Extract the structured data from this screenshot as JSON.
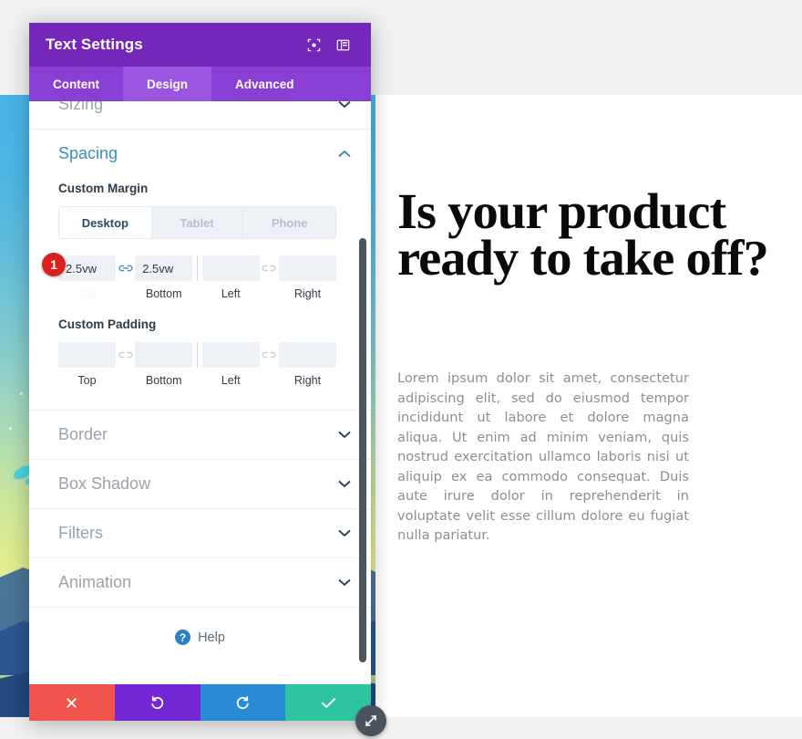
{
  "modal": {
    "title": "Text Settings",
    "header_icons": [
      {
        "name": "focus-target-icon"
      },
      {
        "name": "panel-layout-icon"
      }
    ],
    "tabs": [
      {
        "label": "Content",
        "active": false
      },
      {
        "label": "Design",
        "active": true
      },
      {
        "label": "Advanced",
        "active": false
      }
    ],
    "sections": [
      {
        "label": "Sizing",
        "open": false,
        "chevron": "⌄"
      },
      {
        "label": "Spacing",
        "open": true,
        "chevron": "⌃"
      },
      {
        "label": "Border",
        "open": false,
        "chevron": "⌄"
      },
      {
        "label": "Box Shadow",
        "open": false,
        "chevron": "⌄"
      },
      {
        "label": "Filters",
        "open": false,
        "chevron": "⌄"
      },
      {
        "label": "Animation",
        "open": false,
        "chevron": "⌄"
      }
    ],
    "spacing": {
      "custom_margin_label": "Custom Margin",
      "custom_padding_label": "Custom Padding",
      "devices": [
        {
          "label": "Desktop",
          "active": true
        },
        {
          "label": "Tablet",
          "active": false
        },
        {
          "label": "Phone",
          "active": false
        }
      ],
      "margin": {
        "badge": "1",
        "top": {
          "caption": "Top",
          "value": "2.5vw",
          "placeholder": ""
        },
        "bottom": {
          "caption": "Bottom",
          "value": "2.5vw",
          "placeholder": ""
        },
        "left": {
          "caption": "Left",
          "value": "",
          "placeholder": ""
        },
        "right": {
          "caption": "Right",
          "value": "",
          "placeholder": ""
        },
        "link_state": "linked",
        "link_icon": "linked-chain-icon",
        "unlink_icon": "broken-chain-icon"
      },
      "padding": {
        "top": {
          "caption": "Top",
          "value": "",
          "placeholder": ""
        },
        "bottom": {
          "caption": "Bottom",
          "value": "",
          "placeholder": ""
        },
        "left": {
          "caption": "Left",
          "value": "",
          "placeholder": ""
        },
        "right": {
          "caption": "Right",
          "value": "",
          "placeholder": ""
        },
        "link_state": "unlinked",
        "link_icon": "broken-chain-icon"
      }
    },
    "help": {
      "label": "Help",
      "icon_glyph": "?"
    },
    "footer_buttons": [
      {
        "name": "discard-button",
        "glyph": "✖",
        "color": "#f0544c"
      },
      {
        "name": "undo-button",
        "glyph": "↺",
        "color": "#7427d4"
      },
      {
        "name": "redo-button",
        "glyph": "↻",
        "color": "#2a8ad4"
      },
      {
        "name": "save-button",
        "glyph": "✔",
        "color": "#2ec4a0"
      }
    ],
    "resize_handle_glyph": "⤡"
  },
  "page": {
    "heading": "Is your product ready to take off?",
    "body": "Lorem ipsum dolor sit amet, consectetur adipiscing elit, sed do eiusmod tempor incididunt ut labore et dolore magna aliqua. Ut enim ad minim veniam, quis nostrud exercitation ullamco laboris nisi ut aliquip ex ea commodo consequat. Duis aute irure dolor in reprehenderit in voluptate velit esse cillum dolore eu fugiat nulla pariatur."
  },
  "colors": {
    "header_purple": "#7427b8",
    "tab_purple": "#8a3fd4",
    "tab_active_purple": "#9b55e0",
    "accent_blue": "#3c8dbc",
    "badge_red": "#d82020"
  }
}
